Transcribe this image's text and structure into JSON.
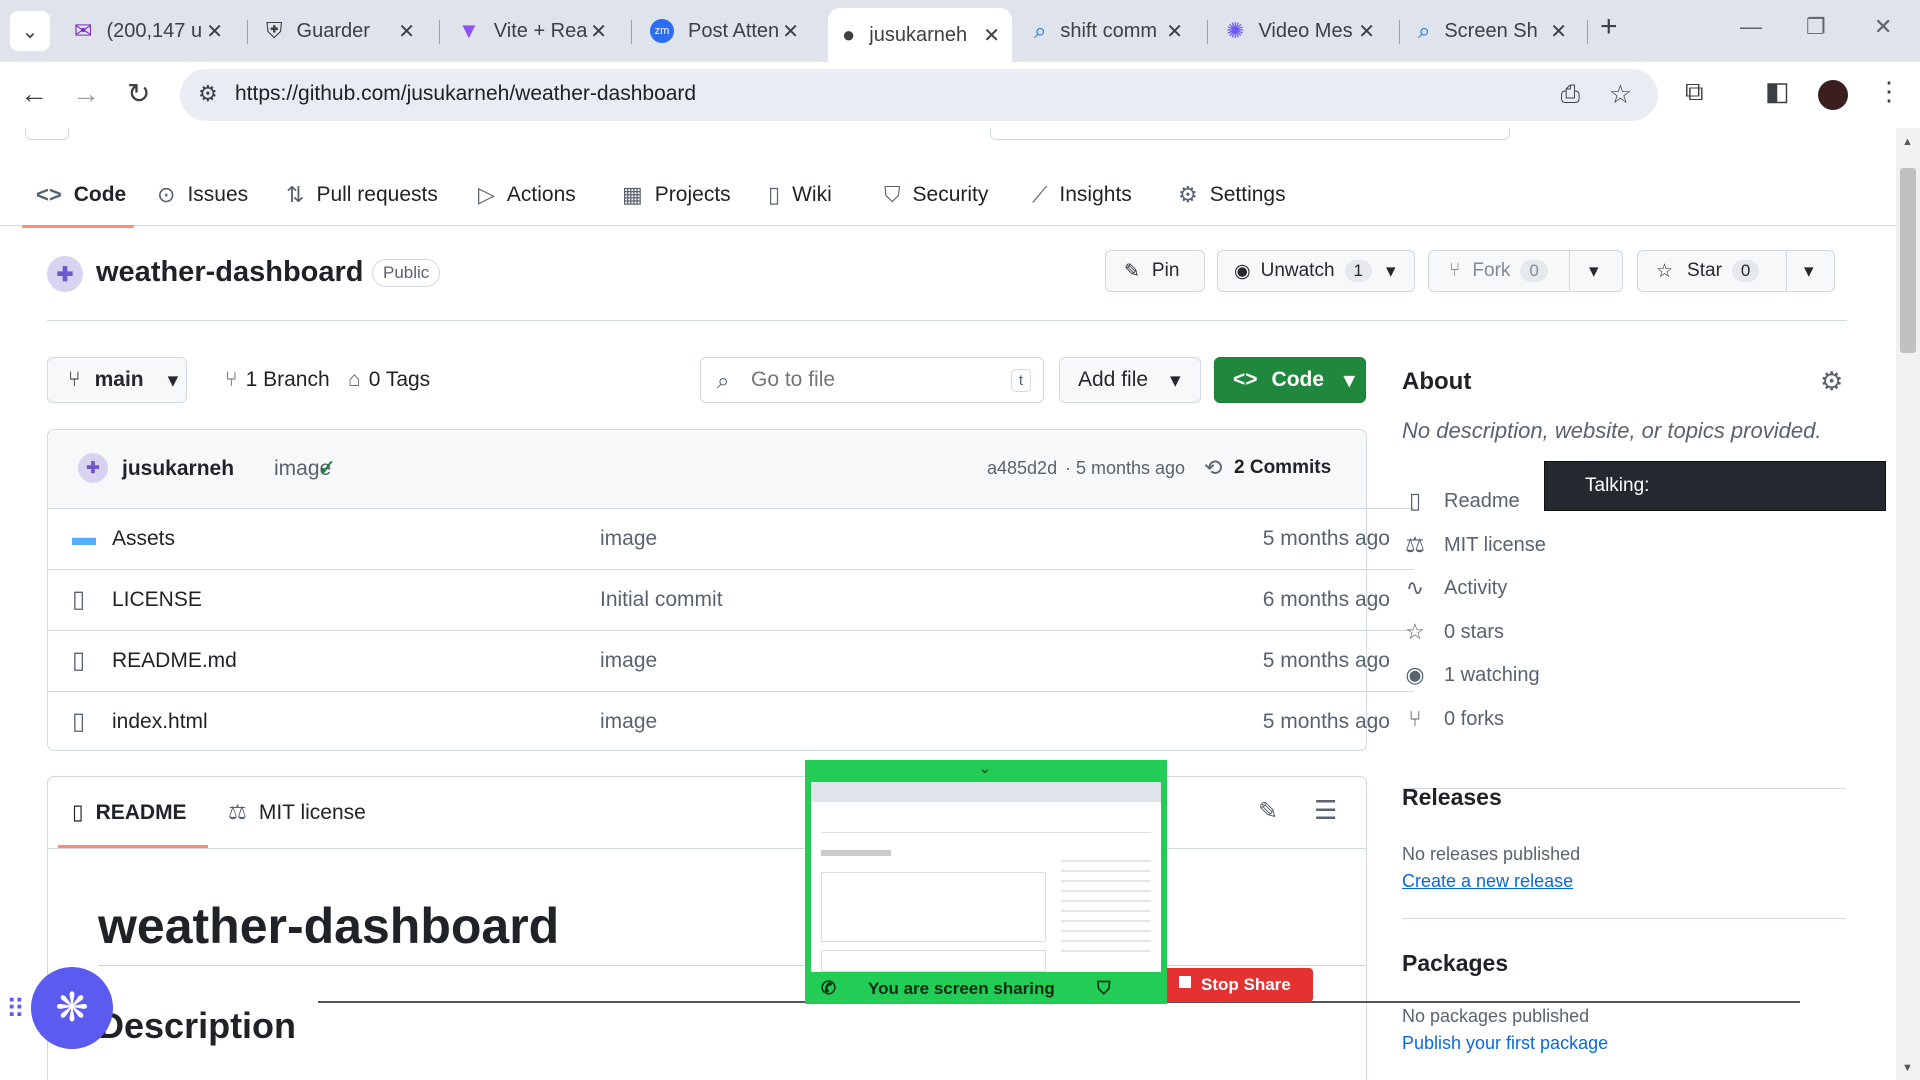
{
  "browser": {
    "tabs": [
      {
        "title": "(200,147 u",
        "icon": "mail-icon"
      },
      {
        "title": "Guarder",
        "icon": "guarder-icon"
      },
      {
        "title": "Vite + Rea",
        "icon": "vite-icon"
      },
      {
        "title": "Post Atten",
        "icon": "zoom-icon"
      },
      {
        "title": "jusukarneh",
        "icon": "github-icon"
      },
      {
        "title": "shift comm",
        "icon": "search-icon"
      },
      {
        "title": "Video Mes",
        "icon": "spark-icon"
      },
      {
        "title": "Screen Sh",
        "icon": "search-icon"
      }
    ],
    "url": "https://github.com/jusukarneh/weather-dashboard"
  },
  "repo_nav": {
    "tabs": [
      "Code",
      "Issues",
      "Pull requests",
      "Actions",
      "Projects",
      "Wiki",
      "Security",
      "Insights",
      "Settings"
    ]
  },
  "repo": {
    "name": "weather-dashboard",
    "visibility": "Public",
    "pin": "Pin",
    "unwatch": "Unwatch",
    "watch_count": "1",
    "fork": "Fork",
    "fork_count": "0",
    "star": "Star",
    "star_count": "0"
  },
  "branchbar": {
    "branch": "main",
    "branches": "1 Branch",
    "tags": "0 Tags",
    "search_placeholder": "Go to file",
    "search_key": "t",
    "add_file": "Add file",
    "code": "Code"
  },
  "commit": {
    "author": "jusukarneh",
    "message": "image",
    "hash": "a485d2d",
    "time": "· 5 months ago",
    "commits": "2 Commits"
  },
  "files": [
    {
      "name": "Assets",
      "message": "image",
      "time": "5 months ago",
      "type": "folder"
    },
    {
      "name": "LICENSE",
      "message": "Initial commit",
      "time": "6 months ago",
      "type": "file"
    },
    {
      "name": "README.md",
      "message": "image",
      "time": "5 months ago",
      "type": "file"
    },
    {
      "name": "index.html",
      "message": "image",
      "time": "5 months ago",
      "type": "file"
    }
  ],
  "readme": {
    "tab_readme": "README",
    "tab_license": "MIT license",
    "title": "weather-dashboard",
    "section": "Description"
  },
  "about": {
    "heading": "About",
    "description": "No description, website, or topics provided.",
    "items": [
      "Readme",
      "MIT license",
      "Activity",
      "0 stars",
      "1 watching",
      "0 forks"
    ],
    "releases_heading": "Releases",
    "releases_text": "No releases published",
    "releases_link": "Create a new release",
    "packages_heading": "Packages",
    "packages_text": "No packages published",
    "packages_link": "Publish your first package"
  },
  "overlay": {
    "talking": "Talking:",
    "sharing": "You are screen sharing",
    "stop": "Stop Share"
  }
}
